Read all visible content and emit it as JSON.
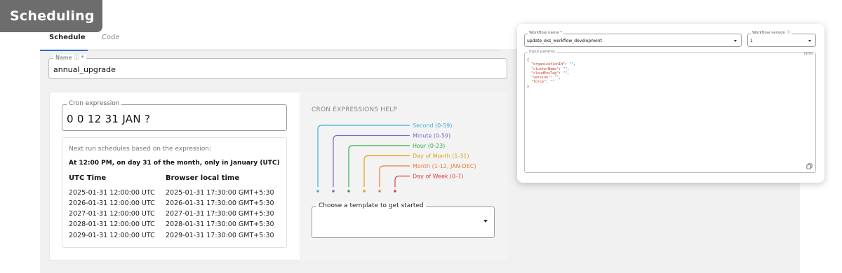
{
  "badge": "Scheduling",
  "tabs": {
    "schedule": "Schedule",
    "code": "Code"
  },
  "name_field": {
    "label": "Name ⓘ *",
    "value": "annual_upgrade"
  },
  "cron": {
    "label": "Cron expression",
    "value": "0 0 12 31 JAN ?",
    "next_intro": "Next run schedules based on the expression:",
    "summary": "At 12:00 PM, on day 31 of the month, only in January (UTC)",
    "utc_header": "UTC Time",
    "local_header": "Browser local time",
    "runs": [
      {
        "utc": "2025-01-31 12:00:00 UTC",
        "local": "2025-01-31 17:30:00 GMT+5:30"
      },
      {
        "utc": "2026-01-31 12:00:00 UTC",
        "local": "2026-01-31 17:30:00 GMT+5:30"
      },
      {
        "utc": "2027-01-31 12:00:00 UTC",
        "local": "2027-01-31 17:30:00 GMT+5:30"
      },
      {
        "utc": "2028-01-31 12:00:00 UTC",
        "local": "2028-01-31 17:30:00 GMT+5:30"
      },
      {
        "utc": "2029-01-31 12:00:00 UTC",
        "local": "2029-01-31 17:30:00 GMT+5:30"
      }
    ]
  },
  "help": {
    "title": "CRON EXPRESSIONS HELP",
    "fields": [
      {
        "label": "Second (0-59)",
        "color": "#3fb0d8"
      },
      {
        "label": "Minute (0-59)",
        "color": "#7b68c9"
      },
      {
        "label": "Hour (0-23)",
        "color": "#2eaa4a"
      },
      {
        "label": "Day of Month (1-31)",
        "color": "#e0a21a"
      },
      {
        "label": "Month (1-12, JAN-DEC)",
        "color": "#ee7b3a"
      },
      {
        "label": "Day of Week (0-7)",
        "color": "#e23b3b"
      }
    ]
  },
  "template_select": {
    "label": "Choose a template to get started",
    "value": ""
  },
  "popover": {
    "workflow_name_label": "Workflow name *",
    "workflow_name_value": "update_eks_workflow_development",
    "workflow_version_label": "Workflow version ⓘ",
    "workflow_version_value": "1",
    "input_params_label": "Input params",
    "json_badge": "JSON",
    "params": [
      {
        "key": "\"organizationId\"",
        "value": "\"\"",
        "sep": ","
      },
      {
        "key": "\"clusterName\"",
        "value": "\"\"",
        "sep": ","
      },
      {
        "key": "\"cloudEnvTag\"",
        "value": "\"\"",
        "sep": ","
      },
      {
        "key": "\"version\"",
        "value": "\"\"",
        "sep": ","
      },
      {
        "key": "\"force\"",
        "value": "\"\"",
        "sep": ""
      }
    ]
  }
}
